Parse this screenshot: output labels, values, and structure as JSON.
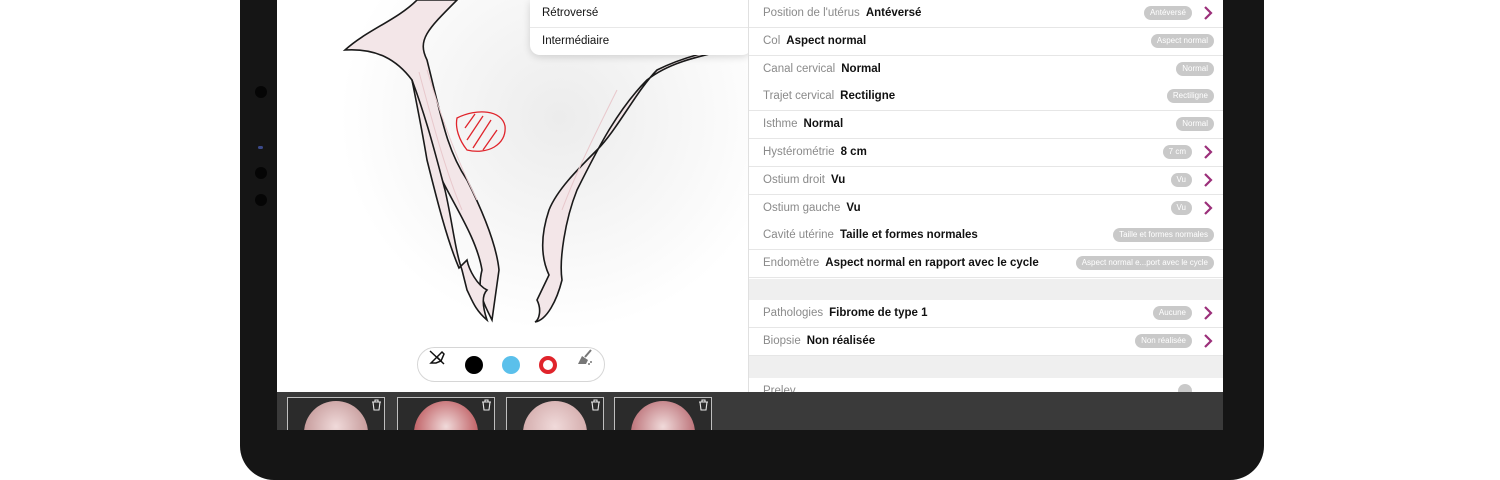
{
  "popup": {
    "options": [
      "Rétroversé",
      "Intermédiaire"
    ]
  },
  "toolbar": {
    "tools": [
      "eraser-tool-icon",
      "black-color-dot",
      "blue-color-dot",
      "red-color-dot",
      "clear-drawing-icon"
    ],
    "colors": {
      "black": "#000000",
      "blue": "#5bc0eb",
      "red": "#e0242b"
    }
  },
  "exam": {
    "rows": [
      {
        "label": "Position de l'utérus",
        "value": "Antéversé",
        "badge": "Antéversé",
        "chevron": true
      },
      {
        "label": "Col",
        "value": "Aspect normal",
        "badge": "Aspect normal",
        "chevron": false
      },
      {
        "label": "Canal cervical",
        "value": "Normal",
        "badge": "Normal",
        "chevron": false
      },
      {
        "label": "Trajet cervical",
        "value": "Rectiligne",
        "badge": "Rectiligne",
        "chevron": false
      },
      {
        "label": "Isthme",
        "value": "Normal",
        "badge": "Normal",
        "chevron": false
      },
      {
        "label": "Hystérométrie",
        "value": "8 cm",
        "badge": "7 cm",
        "chevron": true
      },
      {
        "label": "Ostium droit",
        "value": "Vu",
        "badge": "Vu",
        "chevron": true
      },
      {
        "label": "Ostium gauche",
        "value": "Vu",
        "badge": "Vu",
        "chevron": true
      },
      {
        "label": "Cavité utérine",
        "value": "Taille et formes normales",
        "badge": "Taille et formes normales",
        "chevron": false
      },
      {
        "label": "Endomètre",
        "value": "Aspect normal en rapport avec le cycle",
        "badge": "Aspect normal e...port avec le cycle",
        "chevron": false
      }
    ],
    "rows2": [
      {
        "label": "Pathologies",
        "value": "Fibrome de type 1",
        "badge": "Aucune",
        "chevron": true
      },
      {
        "label": "Biopsie",
        "value": "Non réalisée",
        "badge": "Non réalisée",
        "chevron": true
      }
    ],
    "partial_label": "Prelev"
  },
  "accent_color": "#9b2f7a",
  "thumbnails": [
    {
      "name": "hysteroscopy-image-1"
    },
    {
      "name": "hysteroscopy-image-2"
    },
    {
      "name": "hysteroscopy-image-3"
    },
    {
      "name": "hysteroscopy-image-4"
    }
  ]
}
